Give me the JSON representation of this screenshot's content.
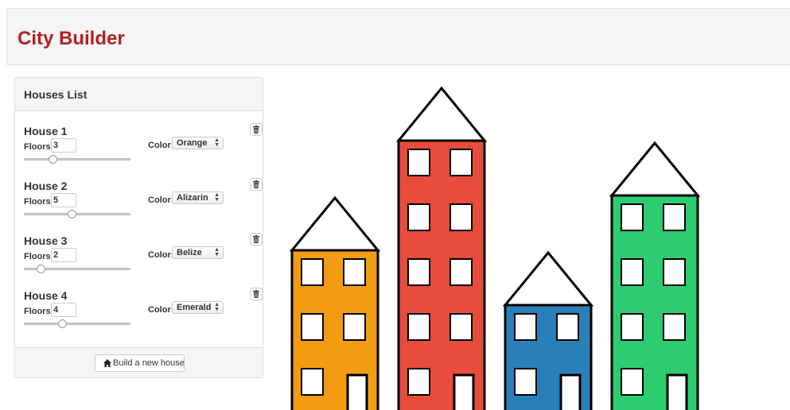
{
  "app": {
    "title": "City Builder"
  },
  "panel": {
    "heading": "Houses List",
    "floors_label": "Floors:",
    "color_label": "Color:",
    "build_button_label": "Build a new house",
    "build_button_icon": "home-icon",
    "delete_icon": "trash-icon"
  },
  "houses": [
    {
      "name": "House 1",
      "floors": "3",
      "color": "Orange",
      "color_hex": "#f39c12",
      "slider_fraction": 0.25
    },
    {
      "name": "House 2",
      "floors": "5",
      "color": "Alizarin",
      "color_hex": "#e74c3c",
      "slider_fraction": 0.45
    },
    {
      "name": "House 3",
      "floors": "2",
      "color": "Belize",
      "color_hex": "#2980b9",
      "slider_fraction": 0.13
    },
    {
      "name": "House 4",
      "floors": "4",
      "color": "Emerald",
      "color_hex": "#2ecc71",
      "slider_fraction": 0.35
    }
  ],
  "theme": {
    "title_color": "#b22222",
    "window_color": "#ffffff",
    "outline_color": "#000000"
  }
}
